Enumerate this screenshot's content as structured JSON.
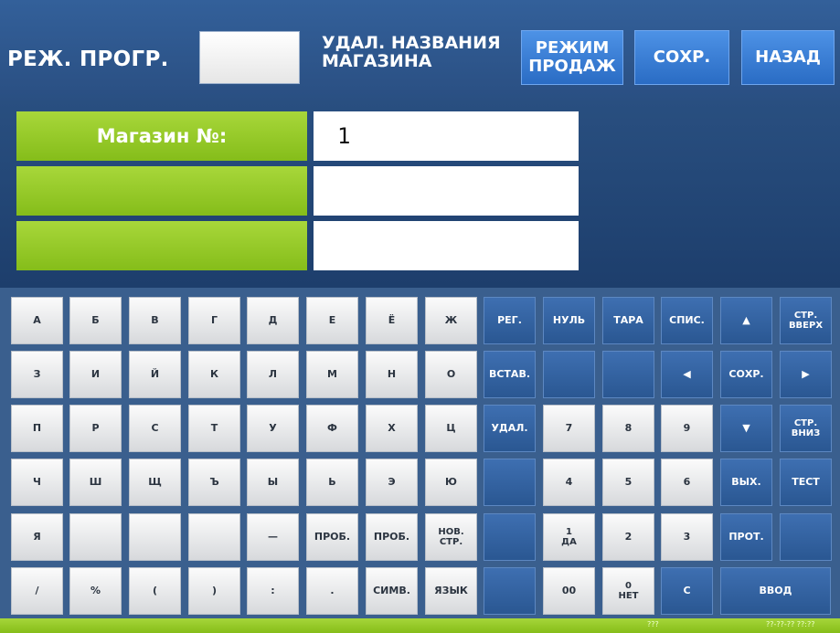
{
  "header": {
    "title": "РЕЖ. ПРОГР.",
    "field_value": "",
    "delete_label_line1": "УДАЛ. НАЗВАНИЯ",
    "delete_label_line2": "МАГАЗИНА",
    "sales_mode_line1": "РЕЖИМ",
    "sales_mode_line2": "ПРОДАЖ",
    "save_label": "СОХР.",
    "back_label": "НАЗАД"
  },
  "fields": [
    {
      "label": "Магазин №:",
      "value": "1"
    },
    {
      "label": "",
      "value": ""
    },
    {
      "label": "",
      "value": ""
    }
  ],
  "keypad": {
    "rows": [
      [
        {
          "label": "А",
          "style": "white",
          "name": "key-a"
        },
        {
          "label": "Б",
          "style": "white",
          "name": "key-b"
        },
        {
          "label": "В",
          "style": "white",
          "name": "key-v"
        },
        {
          "label": "Г",
          "style": "white",
          "name": "key-g"
        },
        {
          "label": "Д",
          "style": "white",
          "name": "key-d"
        },
        {
          "label": "Е",
          "style": "white",
          "name": "key-e"
        },
        {
          "label": "Ё",
          "style": "white",
          "name": "key-yo"
        },
        {
          "label": "Ж",
          "style": "white",
          "name": "key-zh"
        },
        {
          "label": "РЕГ.",
          "style": "blue",
          "name": "key-reg"
        },
        {
          "label": "НУЛЬ",
          "style": "blue",
          "name": "key-zero"
        },
        {
          "label": "ТАРА",
          "style": "blue",
          "name": "key-tare"
        },
        {
          "label": "СПИС.",
          "style": "blue",
          "name": "key-list"
        },
        {
          "label": "▲",
          "style": "blue",
          "name": "key-up"
        },
        {
          "label": "СТР.\nВВЕРХ",
          "style": "blue",
          "name": "key-page-up"
        }
      ],
      [
        {
          "label": "З",
          "style": "white",
          "name": "key-z"
        },
        {
          "label": "И",
          "style": "white",
          "name": "key-i"
        },
        {
          "label": "Й",
          "style": "white",
          "name": "key-iy"
        },
        {
          "label": "К",
          "style": "white",
          "name": "key-k"
        },
        {
          "label": "Л",
          "style": "white",
          "name": "key-l"
        },
        {
          "label": "М",
          "style": "white",
          "name": "key-m"
        },
        {
          "label": "Н",
          "style": "white",
          "name": "key-n"
        },
        {
          "label": "О",
          "style": "white",
          "name": "key-o"
        },
        {
          "label": "ВСТАВ.",
          "style": "blue",
          "name": "key-insert"
        },
        {
          "label": "",
          "style": "blue",
          "name": "key-blank"
        },
        {
          "label": "",
          "style": "blue",
          "name": "key-blank"
        },
        {
          "label": "◀",
          "style": "blue",
          "name": "key-left"
        },
        {
          "label": "СОХР.",
          "style": "blue",
          "name": "key-save"
        },
        {
          "label": "▶",
          "style": "blue",
          "name": "key-right"
        }
      ],
      [
        {
          "label": "П",
          "style": "white",
          "name": "key-p"
        },
        {
          "label": "Р",
          "style": "white",
          "name": "key-r"
        },
        {
          "label": "С",
          "style": "white",
          "name": "key-s"
        },
        {
          "label": "Т",
          "style": "white",
          "name": "key-t"
        },
        {
          "label": "У",
          "style": "white",
          "name": "key-u"
        },
        {
          "label": "Ф",
          "style": "white",
          "name": "key-f"
        },
        {
          "label": "Х",
          "style": "white",
          "name": "key-kh"
        },
        {
          "label": "Ц",
          "style": "white",
          "name": "key-ts"
        },
        {
          "label": "УДАЛ.",
          "style": "blue",
          "name": "key-delete"
        },
        {
          "label": "7",
          "style": "white",
          "name": "key-7"
        },
        {
          "label": "8",
          "style": "white",
          "name": "key-8"
        },
        {
          "label": "9",
          "style": "white",
          "name": "key-9"
        },
        {
          "label": "▼",
          "style": "blue",
          "name": "key-down"
        },
        {
          "label": "СТР.\nВНИЗ",
          "style": "blue",
          "name": "key-page-down"
        }
      ],
      [
        {
          "label": "Ч",
          "style": "white",
          "name": "key-ch"
        },
        {
          "label": "Ш",
          "style": "white",
          "name": "key-sh"
        },
        {
          "label": "Щ",
          "style": "white",
          "name": "key-shch"
        },
        {
          "label": "Ъ",
          "style": "white",
          "name": "key-hard-sign"
        },
        {
          "label": "Ы",
          "style": "white",
          "name": "key-y"
        },
        {
          "label": "Ь",
          "style": "white",
          "name": "key-soft-sign"
        },
        {
          "label": "Э",
          "style": "white",
          "name": "key-eh"
        },
        {
          "label": "Ю",
          "style": "white",
          "name": "key-yu"
        },
        {
          "label": "",
          "style": "blue",
          "name": "key-blank"
        },
        {
          "label": "4",
          "style": "white",
          "name": "key-4"
        },
        {
          "label": "5",
          "style": "white",
          "name": "key-5"
        },
        {
          "label": "6",
          "style": "white",
          "name": "key-6"
        },
        {
          "label": "ВЫХ.",
          "style": "blue",
          "name": "key-exit"
        },
        {
          "label": "ТЕСТ",
          "style": "blue",
          "name": "key-test"
        }
      ],
      [
        {
          "label": "Я",
          "style": "white",
          "name": "key-ya"
        },
        {
          "label": "",
          "style": "white",
          "name": "key-blank"
        },
        {
          "label": "",
          "style": "white",
          "name": "key-blank"
        },
        {
          "label": "",
          "style": "white",
          "name": "key-blank"
        },
        {
          "label": "—",
          "style": "white",
          "name": "key-dash"
        },
        {
          "label": "ПРОБ.",
          "style": "white",
          "name": "key-space"
        },
        {
          "label": "ПРОБ.",
          "style": "white",
          "name": "key-space"
        },
        {
          "label": "НОВ.\nСТР.",
          "style": "white",
          "name": "key-new-line"
        },
        {
          "label": "",
          "style": "blue",
          "name": "key-blank"
        },
        {
          "label": "1\nДА",
          "style": "white",
          "name": "key-1-yes"
        },
        {
          "label": "2",
          "style": "white",
          "name": "key-2"
        },
        {
          "label": "3",
          "style": "white",
          "name": "key-3"
        },
        {
          "label": "ПРОТ.",
          "style": "blue",
          "name": "key-prot"
        },
        {
          "label": "",
          "style": "blue",
          "name": "key-blank"
        }
      ],
      [
        {
          "label": "/",
          "style": "white",
          "name": "key-slash"
        },
        {
          "label": "%",
          "style": "white",
          "name": "key-percent"
        },
        {
          "label": "(",
          "style": "white",
          "name": "key-paren-open"
        },
        {
          "label": ")",
          "style": "white",
          "name": "key-paren-close"
        },
        {
          "label": ":",
          "style": "white",
          "name": "key-colon"
        },
        {
          "label": ".",
          "style": "white",
          "name": "key-period"
        },
        {
          "label": "СИМВ.",
          "style": "white",
          "name": "key-symbols"
        },
        {
          "label": "ЯЗЫК",
          "style": "white",
          "name": "key-language"
        },
        {
          "label": "",
          "style": "blue",
          "name": "key-blank"
        },
        {
          "label": "00",
          "style": "white",
          "name": "key-00"
        },
        {
          "label": "0\nНЕТ",
          "style": "white",
          "name": "key-0-no"
        },
        {
          "label": "C",
          "style": "blue",
          "name": "key-clear"
        },
        {
          "label": "ВВОД",
          "style": "blue",
          "name": "key-enter",
          "wide": true
        }
      ]
    ]
  },
  "colors": {
    "header_bg": "#2f5a92",
    "header_button": "#3a7fd8",
    "label_green": "#95c92a",
    "key_white": "#ececec",
    "key_blue": "#3464a3",
    "footer_green": "#95c92a"
  },
  "footer": {
    "left_text": "",
    "status_text": "???",
    "datetime_text": "??-??-?? ??:??"
  }
}
